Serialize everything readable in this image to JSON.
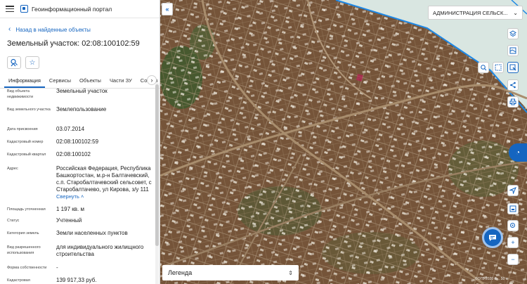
{
  "header": {
    "title": "Геоинформационный портал"
  },
  "nav": {
    "back_label": "Назад в найденные объекты"
  },
  "object": {
    "title": "Земельный участок: 02:08:100102:59"
  },
  "tabs": [
    {
      "label": "Информация"
    },
    {
      "label": "Сервисы"
    },
    {
      "label": "Объекты"
    },
    {
      "label": "Части ЗУ"
    },
    {
      "label": "Состав"
    }
  ],
  "properties": [
    {
      "label": "Вид объекта недвижимости",
      "value": "Земельный участок"
    },
    {
      "label": "Вид земельного участка",
      "value": "Землепользование"
    },
    {
      "label": "Дата присвоения",
      "value": "03.07.2014"
    },
    {
      "label": "Кадастровый номер",
      "value": "02:08:100102:59"
    },
    {
      "label": "Кадастровый квартал",
      "value": "02:08:100102"
    },
    {
      "label": "Адрес",
      "value": "Российская Федерация, Республика Башкортостан, м.р-н Балтачевский, с.п. Старобалтачевский сельсовет, с Старобалтачево, ул Кирова, з/у 111",
      "more": "Свернуть"
    },
    {
      "label": "Площадь уточненная",
      "value": "1 197 кв. м"
    },
    {
      "label": "Статус",
      "value": "Учтенный"
    },
    {
      "label": "Категория земель",
      "value": "Земли населенных пунктов"
    },
    {
      "label": "Вид разрешенного использования",
      "value": "для индивидуального жилищного строительства"
    },
    {
      "label": "Форма собственности",
      "value": "-"
    },
    {
      "label": "Кадастровая",
      "value": "139 917,33 руб."
    }
  ],
  "map": {
    "admin_select": "АДМИНИСТРАЦИЯ СЕЛЬСК...",
    "legend_label": "Легенда",
    "attribution": "©ОГБ 2020 ©... 50 м"
  },
  "icons": {
    "collapse": "double-chevron-left-icon",
    "layers": "layers-icon",
    "basemap": "basemap-icon",
    "search-area": "search-area-icon",
    "measure": "measure-icon",
    "select": "select-icon",
    "share": "share-icon",
    "print": "print-icon",
    "geolocate": "geolocate-icon",
    "zoom-in": "plus-icon",
    "zoom-out": "minus-icon",
    "chat": "chat-icon"
  },
  "colors": {
    "accent": "#1565c0"
  }
}
